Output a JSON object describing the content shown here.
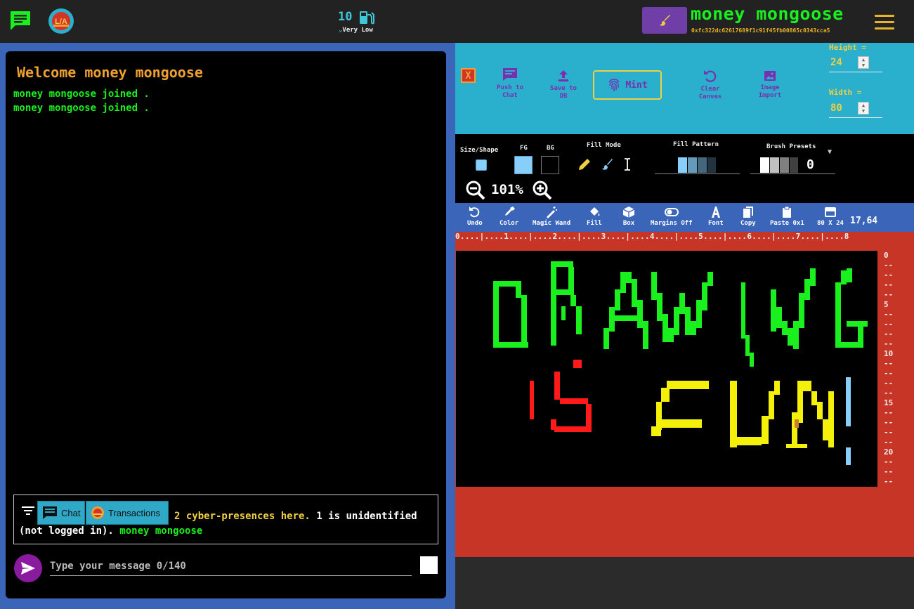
{
  "header": {
    "gas_value": "10",
    "gas_level": "Very Low",
    "username": "money mongoose",
    "address": "0xfc322dc62617689f1c91f45fb00865c0343cca5"
  },
  "chat": {
    "welcome": "Welcome money mongoose",
    "messages": [
      "money mongoose joined .",
      "money mongoose joined ."
    ],
    "tabs": {
      "chat": "Chat",
      "transactions": "Transactions"
    },
    "presence_count": "2 cyber-presences here.",
    "presence_rest": "1 is unidentified (not logged in).",
    "presence_user": "money mongoose",
    "input_placeholder": "Type your message 0/140"
  },
  "editor": {
    "close_label": "X",
    "push_label": "Push to Chat",
    "save_label": "Save to DB",
    "mint_label": "Mint",
    "clear_label": "Clear Canvas",
    "import_label": "Image Import",
    "height_label": "Height =",
    "height_value": "24",
    "width_label": "Width =",
    "width_value": "80",
    "size_shape_label": "Size/Shape",
    "fg_label": "FG",
    "bg_label": "BG",
    "fill_mode_label": "Fill Mode",
    "fill_pattern_label": "Fill Pattern",
    "brush_presets_label": "Brush Presets",
    "brush_preset_value": "0",
    "zoom_level": "101%",
    "fg_color": "#87cefa",
    "bg_color": "#000000",
    "tools": [
      {
        "label": "Undo",
        "icon": "undo-icon"
      },
      {
        "label": "Color",
        "icon": "eyedropper-icon"
      },
      {
        "label": "Magic Wand",
        "icon": "magic-wand-icon"
      },
      {
        "label": "Fill",
        "icon": "fill-bucket-icon"
      },
      {
        "label": "Box",
        "icon": "box-icon"
      },
      {
        "label": "Margins Off",
        "icon": "margins-icon"
      },
      {
        "label": "Font",
        "icon": "font-icon"
      },
      {
        "label": "Copy",
        "icon": "copy-icon"
      },
      {
        "label": "Paste 0x1",
        "icon": "paste-icon"
      },
      {
        "label": "80 X 24",
        "icon": "grid-size-icon"
      }
    ],
    "cursor_coords": "17,64",
    "ruler_top": "0....|....1....|....2....|....3....|....4....|....5....|....6....|....7....|....8",
    "ruler_side": [
      "0",
      "--",
      "--",
      "--",
      "--",
      "5",
      "--",
      "--",
      "--",
      "--",
      "10",
      "--",
      "--",
      "--",
      "--",
      "15",
      "--",
      "--",
      "--",
      "--",
      "20",
      "--",
      "--",
      "--"
    ]
  },
  "colors": {
    "green_text": "#19f01e",
    "orange_text": "#f0a030",
    "yellow_text": "#f0d040",
    "teal_panel": "#2aafcc",
    "red_canvas": "#c73527",
    "blue_panel": "#3a65b8",
    "purple": "#7a2fb0"
  }
}
